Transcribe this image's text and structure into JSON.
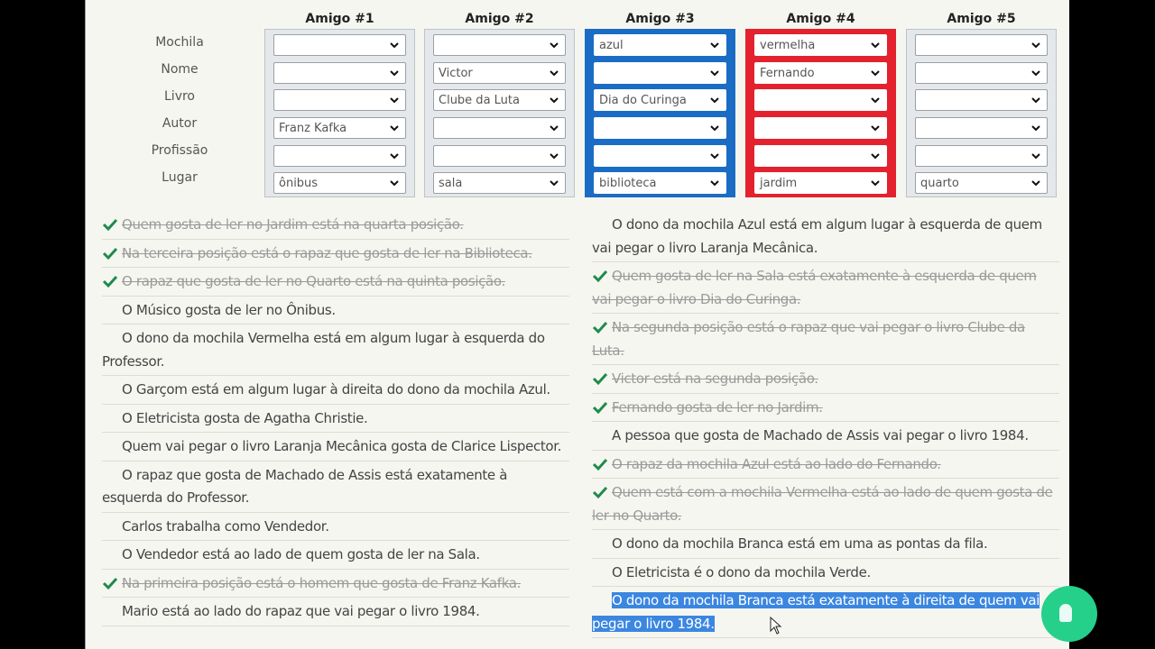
{
  "grid": {
    "row_labels": [
      "Mochila",
      "Nome",
      "Livro",
      "Autor",
      "Profissão",
      "Lugar"
    ],
    "friends": [
      {
        "title": "Amigo #1",
        "highlight": "none",
        "values": [
          "",
          "",
          "",
          "Franz Kafka",
          "",
          "ônibus"
        ]
      },
      {
        "title": "Amigo #2",
        "highlight": "none",
        "values": [
          "",
          "Victor",
          "Clube da Luta",
          "",
          "",
          "sala"
        ]
      },
      {
        "title": "Amigo #3",
        "highlight": "blue",
        "values": [
          "azul",
          "",
          "Dia do Curinga",
          "",
          "",
          "biblioteca"
        ]
      },
      {
        "title": "Amigo #4",
        "highlight": "red",
        "values": [
          "vermelha",
          "Fernando",
          "",
          "",
          "",
          "jardim"
        ]
      },
      {
        "title": "Amigo #5",
        "highlight": "none",
        "values": [
          "",
          "",
          "",
          "",
          "",
          "quarto"
        ]
      }
    ],
    "colors": {
      "blue": "#1a6cc4",
      "red": "#e3222e",
      "check_green": "#1e8a4c",
      "selection": "#3b86e0"
    }
  },
  "clues": {
    "left": [
      {
        "text": "Quem gosta de ler no Jardim está na quarta posição.",
        "done": true
      },
      {
        "text": "Na terceira posição está o rapaz que gosta de ler na Biblioteca.",
        "done": true
      },
      {
        "text": "O rapaz que gosta de ler no Quarto está na quinta posição.",
        "done": true
      },
      {
        "text": "O Músico gosta de ler no Ônibus.",
        "done": false
      },
      {
        "text": "O dono da mochila Vermelha está em algum lugar à esquerda do Professor.",
        "done": false
      },
      {
        "text": "O Garçom está em algum lugar à direita do dono da mochila Azul.",
        "done": false
      },
      {
        "text": "O Eletricista gosta de Agatha Christie.",
        "done": false
      },
      {
        "text": "Quem vai pegar o livro Laranja Mecânica gosta de Clarice Lispector.",
        "done": false
      },
      {
        "text": "O rapaz que gosta de Machado de Assis está exatamente à esquerda do Professor.",
        "done": false
      },
      {
        "text": "Carlos trabalha como Vendedor.",
        "done": false
      },
      {
        "text": "O Vendedor está ao lado de quem gosta de ler na Sala.",
        "done": false
      },
      {
        "text": "Na primeira posição está o homem que gosta de Franz Kafka.",
        "done": true
      },
      {
        "text": "Mario está ao lado do rapaz que vai pegar o livro 1984.",
        "done": false
      }
    ],
    "right": [
      {
        "text": "O dono da mochila Azul está em algum lugar à esquerda de quem vai pegar o livro Laranja Mecânica.",
        "done": false
      },
      {
        "text": "Quem gosta de ler na Sala está exatamente à esquerda de quem vai pegar o livro Dia do Curinga.",
        "done": true
      },
      {
        "text": "Na segunda posição está o rapaz que vai pegar o livro Clube da Luta.",
        "done": true
      },
      {
        "text": "Victor está na segunda posição.",
        "done": true
      },
      {
        "text": "Fernando gosta de ler no Jardim.",
        "done": true
      },
      {
        "text": "A pessoa que gosta de Machado de Assis vai pegar o livro 1984.",
        "done": false
      },
      {
        "text": "O rapaz da mochila Azul está ao lado do Fernando.",
        "done": true
      },
      {
        "text": "Quem está com a mochila Vermelha está ao lado de quem gosta de ler no Quarto.",
        "done": true
      },
      {
        "text": "O dono da mochila Branca está em uma as pontas da fila.",
        "done": false
      },
      {
        "text": "O Eletricista é o dono da mochila Verde.",
        "done": false
      },
      {
        "text": "O dono da mochila Branca está exatamente à direita de quem vai pegar o livro 1984.",
        "done": false,
        "selected": true
      }
    ]
  },
  "overlay": {
    "chat_button_icon": "chat-bubble-icon"
  }
}
